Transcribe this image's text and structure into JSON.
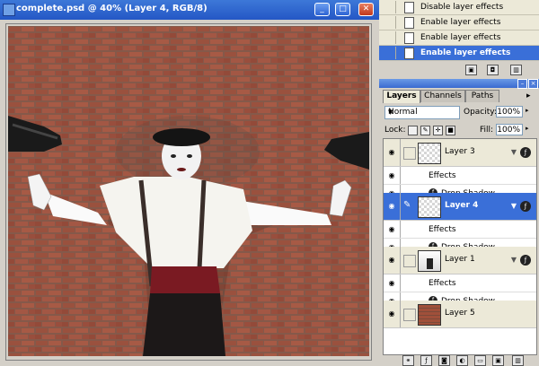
{
  "document": {
    "title": "complete.psd @ 40% (Layer 4, RGB/8)",
    "minimize": "_",
    "maximize": "□",
    "close": "✕"
  },
  "history": {
    "items": [
      {
        "label": "Disable layer effects",
        "selected": false
      },
      {
        "label": "Enable layer effects",
        "selected": false
      },
      {
        "label": "Enable layer effects",
        "selected": false
      },
      {
        "label": "Enable layer effects",
        "selected": true
      }
    ]
  },
  "layers_panel": {
    "tabs": [
      {
        "label": "Layers",
        "active": true
      },
      {
        "label": "Channels",
        "active": false
      },
      {
        "label": "Paths",
        "active": false
      }
    ],
    "blend_mode": "Normal",
    "opacity_label": "Opacity:",
    "opacity_value": "100%",
    "lock_label": "Lock:",
    "fill_label": "Fill:",
    "fill_value": "100%",
    "layers": [
      {
        "name": "Layer 3",
        "selected": false,
        "effects_label": "Effects",
        "effect": "Drop Shadow"
      },
      {
        "name": "Layer 4",
        "selected": true,
        "effects_label": "Effects",
        "effect": "Drop Shadow"
      },
      {
        "name": "Layer 1",
        "selected": false,
        "effects_label": "Effects",
        "effect": "Drop Shadow"
      },
      {
        "name": "Layer 5",
        "selected": false
      }
    ]
  },
  "colors": {
    "titlebar": "#2f66d0",
    "selection": "#3a6fd8",
    "brick": "#9a4a36"
  }
}
